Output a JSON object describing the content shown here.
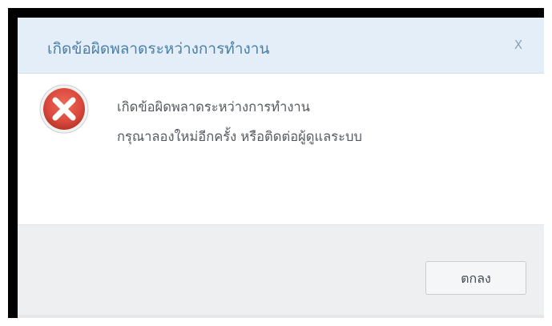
{
  "dialog": {
    "title": "เกิดข้อผิดพลาดระหว่างการทำงาน",
    "close_label": "X",
    "icon": "error-icon",
    "message_line1": "เกิดข้อผิดพลาดระหว่างการทำงาน",
    "message_line2": "กรุณาลองใหม่อีกครั้ง หรือติดต่อผู้ดูแลระบบ",
    "ok_label": "ตกลง"
  },
  "colors": {
    "title_text": "#4b7fa7",
    "titlebar_bg": "#e3eef8",
    "error_red": "#d9483b",
    "footer_bg": "#eeeff1"
  }
}
